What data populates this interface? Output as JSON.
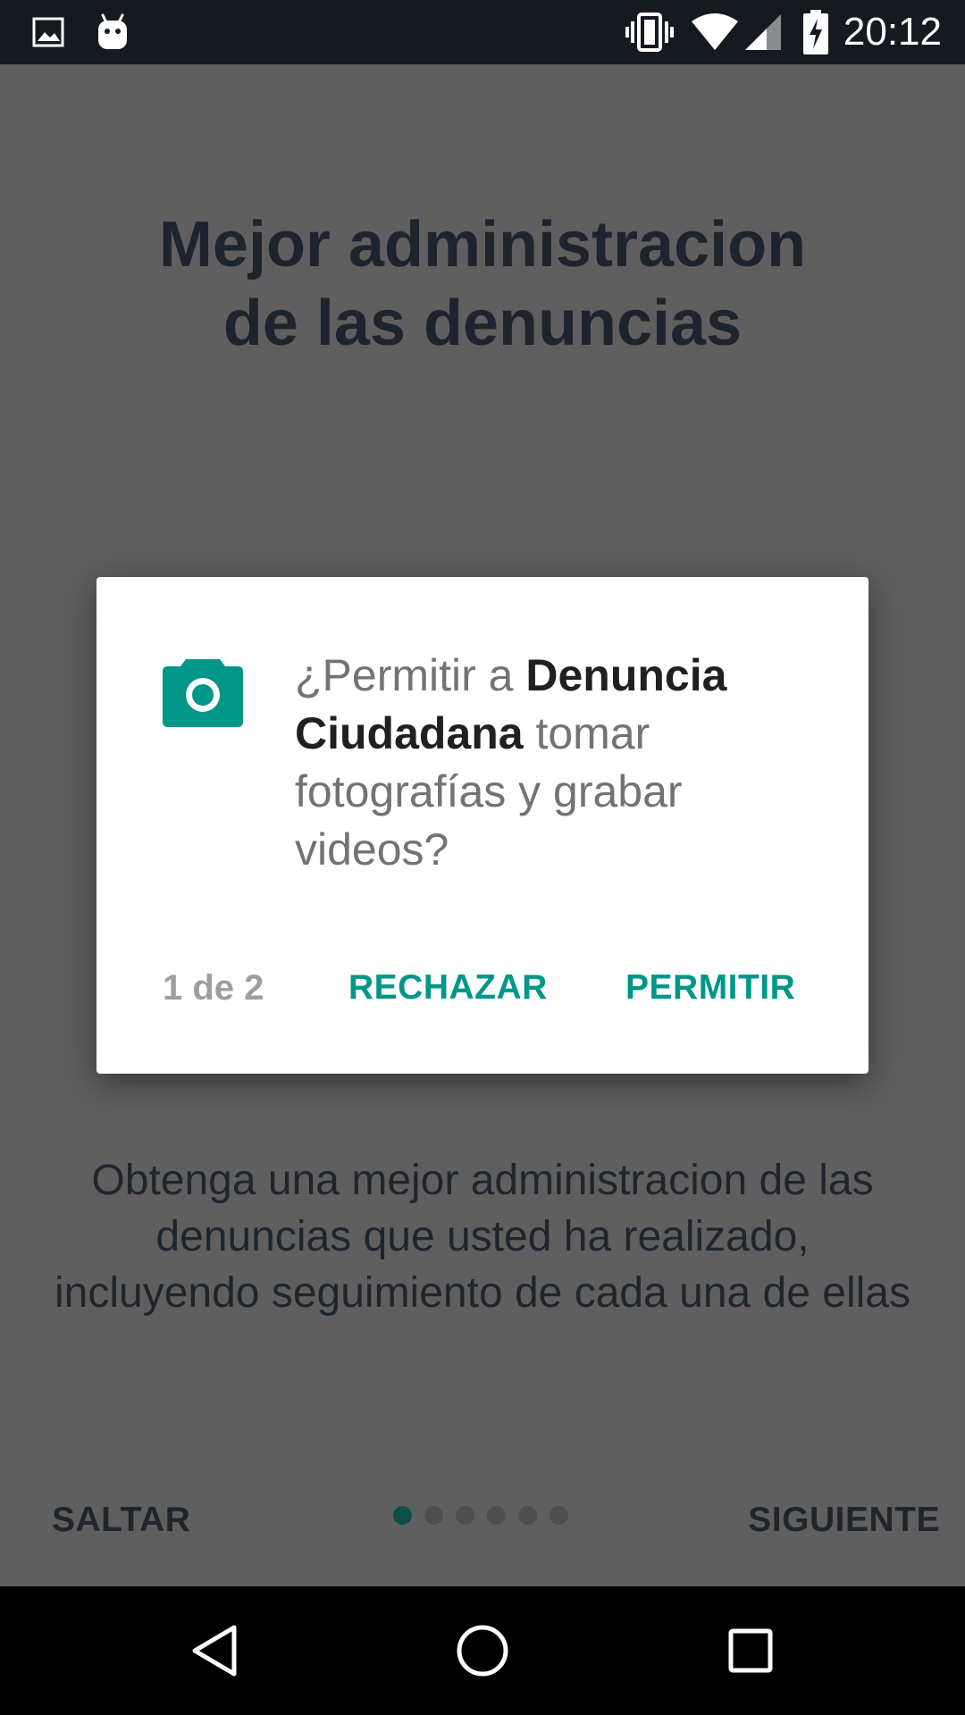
{
  "status_bar": {
    "time": "20:12",
    "icons": [
      "image-icon",
      "android-icon",
      "vibrate-icon",
      "wifi-icon",
      "signal-icon",
      "battery-charging-icon"
    ]
  },
  "onboarding": {
    "title_line1": "Mejor administracion",
    "title_line2": "de las denuncias",
    "description": "Obtenga una mejor administracion de las denuncias que usted ha realizado, incluyendo seguimiento de cada una de ellas",
    "skip_label": "SALTAR",
    "next_label": "SIGUIENTE",
    "page_dots": 6,
    "active_dot": 1
  },
  "permission_dialog": {
    "icon": "camera-icon",
    "prefix": "¿Permitir a ",
    "app_name": "Denuncia Ciudadana",
    "suffix": " tomar fotografías y grabar videos?",
    "counter": "1 de 2",
    "deny_label": "RECHAZAR",
    "allow_label": "PERMITIR"
  },
  "nav_bar": {
    "icons": [
      "back-icon",
      "home-icon",
      "recents-icon"
    ]
  },
  "colors": {
    "accent": "#009688",
    "status_bar": "#141a20",
    "scrim_background": "#5f5f5f",
    "active_dot": "#0d4f48"
  }
}
